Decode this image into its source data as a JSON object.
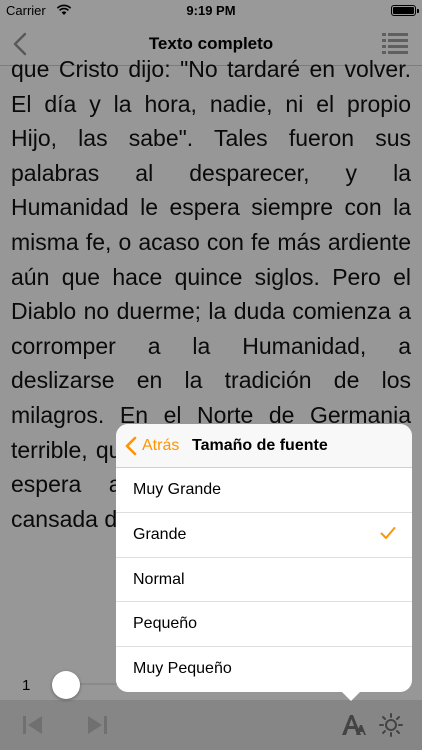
{
  "status_bar": {
    "carrier": "Carrier",
    "time": "9:19 PM"
  },
  "nav": {
    "title": "Texto completo"
  },
  "reader": {
    "text": "que Cristo dijo: \"No tardaré en volver. El día y la hora, nadie, ni el propio Hijo, las sabe\". Tales fueron sus palabras al desparecer, y la Humanidad le espera siempre con la misma fe, o acaso con fe más ardiente aún que hace quince siglos. Pero el Diablo no duerme; la duda comienza a corromper a la Humanidad, a deslizarse en la tradición de los milagros. En el Norte de Germania terrible, que niega milagros. creen con espera a morir con Humanidad cansada de tantos siglos, ha gotado"
  },
  "font_popover": {
    "back_label": "Atrás",
    "title": "Tamaño de fuente",
    "selected": "Grande",
    "options": [
      "Muy Grande",
      "Grande",
      "Normal",
      "Pequeño",
      "Muy Pequeño"
    ]
  },
  "slider": {
    "value": "1"
  },
  "colors": {
    "accent": "#ff9500"
  }
}
